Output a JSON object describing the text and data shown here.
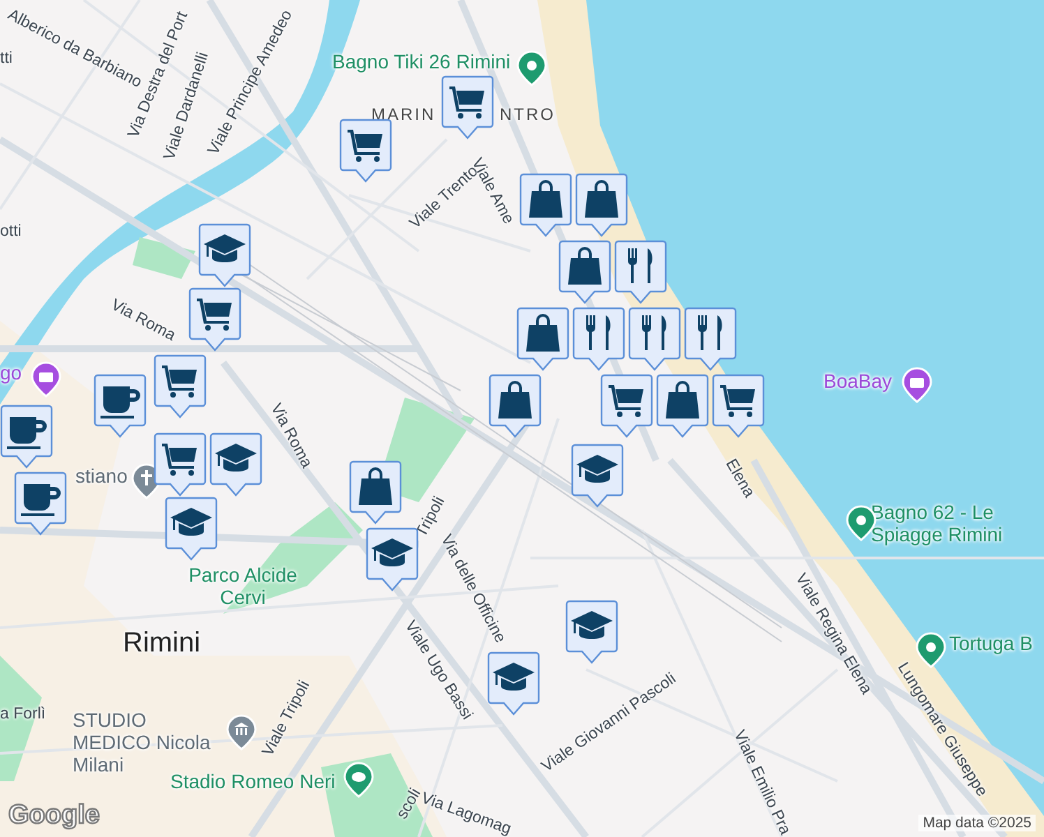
{
  "labels": [
    {
      "text": "Alberico da Barbiano",
      "kind": "street"
    },
    {
      "text": "Via Destra del Port",
      "kind": "street"
    },
    {
      "text": "Viale Dardanelli",
      "kind": "street"
    },
    {
      "text": "Viale Principe Amedeo",
      "kind": "street"
    },
    {
      "text": "tti",
      "kind": "street"
    },
    {
      "text": "otti",
      "kind": "street"
    },
    {
      "text": "Bagno Tiki 26 Rimini",
      "kind": "beach-poi"
    },
    {
      "text": "MARIN",
      "kind": "district"
    },
    {
      "text": "NTRO",
      "kind": "district"
    },
    {
      "text": "Viale Trento",
      "kind": "street"
    },
    {
      "text": "Viale Ame",
      "kind": "street"
    },
    {
      "text": "Via Roma",
      "kind": "street"
    },
    {
      "text": "Via Roma",
      "kind": "street"
    },
    {
      "text": "go",
      "kind": "attraction"
    },
    {
      "text": "stiano",
      "kind": "church"
    },
    {
      "text": "Parco Alcide Cervi",
      "kind": "park"
    },
    {
      "text": "Rimini",
      "kind": "city"
    },
    {
      "text": "a Forlì",
      "kind": "street"
    },
    {
      "text": "STUDIO MEDICO Nicola Milani",
      "kind": "medical"
    },
    {
      "text": "Stadio Romeo Neri",
      "kind": "stadium"
    },
    {
      "text": "Viale Tripoli",
      "kind": "street"
    },
    {
      "text": "Tripoli",
      "kind": "street"
    },
    {
      "text": "Via delle Officine",
      "kind": "street"
    },
    {
      "text": "Viale Ugo Bassi",
      "kind": "street"
    },
    {
      "text": "Via Lagomag",
      "kind": "street"
    },
    {
      "text": "scoli",
      "kind": "street"
    },
    {
      "text": "Viale Giovanni Pascoli",
      "kind": "street"
    },
    {
      "text": "Viale Emilio Pra",
      "kind": "street"
    },
    {
      "text": "Viale Regina Elena",
      "kind": "street"
    },
    {
      "text": "Lungomare Giuseppe",
      "kind": "street"
    },
    {
      "text": "Elena",
      "kind": "street"
    },
    {
      "text": "BoaBay",
      "kind": "attraction"
    },
    {
      "text": "Bagno 62 - Le Spiagge Rimini",
      "kind": "beach-poi"
    },
    {
      "text": "Tortuga B",
      "kind": "beach-poi"
    }
  ],
  "markers": [
    {
      "kind": "cart"
    },
    {
      "kind": "cart"
    },
    {
      "kind": "bag"
    },
    {
      "kind": "bag"
    },
    {
      "kind": "bag"
    },
    {
      "kind": "fork"
    },
    {
      "kind": "cap"
    },
    {
      "kind": "cart"
    },
    {
      "kind": "cart"
    },
    {
      "kind": "cup"
    },
    {
      "kind": "cup"
    },
    {
      "kind": "cup"
    },
    {
      "kind": "cart"
    },
    {
      "kind": "cap"
    },
    {
      "kind": "cap"
    },
    {
      "kind": "bag"
    },
    {
      "kind": "fork"
    },
    {
      "kind": "fork"
    },
    {
      "kind": "fork"
    },
    {
      "kind": "bag"
    },
    {
      "kind": "cart"
    },
    {
      "kind": "bag"
    },
    {
      "kind": "cart"
    },
    {
      "kind": "cap"
    },
    {
      "kind": "bag"
    },
    {
      "kind": "cap"
    },
    {
      "kind": "cap"
    },
    {
      "kind": "cap"
    }
  ],
  "logo": "Google",
  "attribution": "Map data ©2025"
}
